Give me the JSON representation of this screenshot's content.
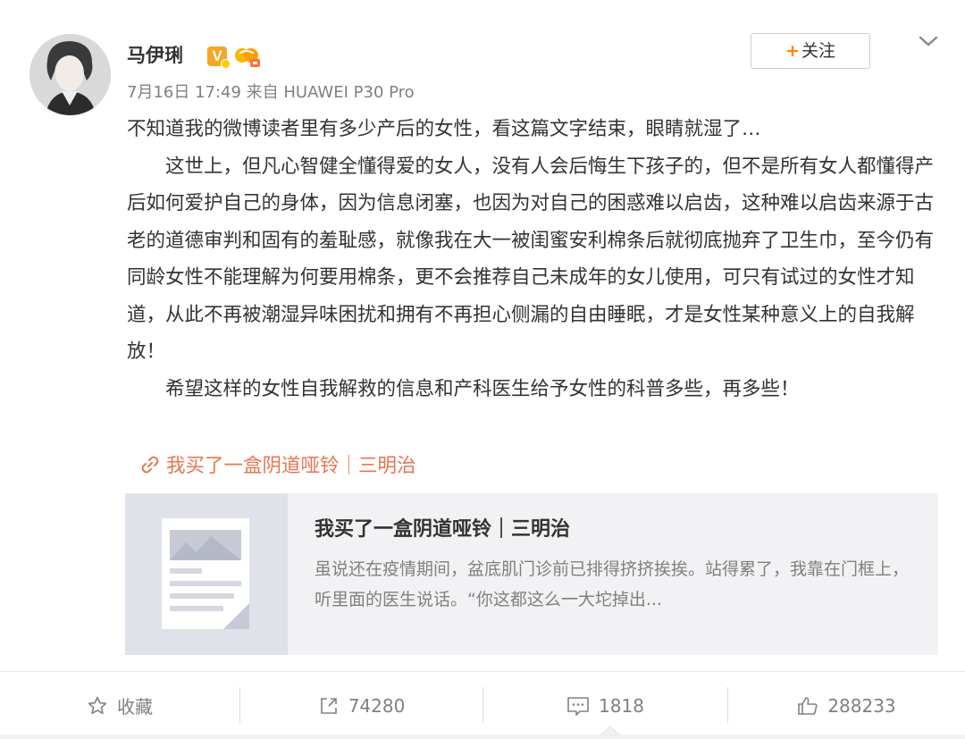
{
  "colors": {
    "accent": "#ff8200",
    "link": "#eb7350",
    "meta": "#808080",
    "text": "#333333",
    "card_bg": "#f2f2f5"
  },
  "post": {
    "author": "马伊琍",
    "verified_badge": "V",
    "meta": "7月16日 17:49 来自 HUAWEI P30 Pro",
    "follow_label": "关注",
    "follow_icon": "plus-icon",
    "menu_icon": "chevron-down-icon",
    "paragraphs": [
      "不知道我的微博读者里有多少产后的女性，看这篇文字结束，眼睛就湿了…",
      "这世上，但凡心智健全懂得爱的女人，没有人会后悔生下孩子的，但不是所有女人都懂得产后如何爱护自己的身体，因为信息闭塞，也因为对自己的困惑难以启齿，这种难以启齿来源于古老的道德审判和固有的羞耻感，就像我在大一被闺蜜安利棉条后就彻底抛弃了卫生巾，至今仍有同龄女性不能理解为何要用棉条，更不会推荐自己未成年的女儿使用，可只有试过的女性才知道，从此不再被潮湿异味困扰和拥有不再担心侧漏的自由睡眠，才是女性某种意义上的自我解放！",
      "希望这样的女性自我解救的信息和产科医生给予女性的科普多些，再多些！"
    ],
    "link_text": "我买了一盒阴道哑铃｜三明治",
    "link_icon": "link-icon"
  },
  "card": {
    "title": "我买了一盒阴道哑铃｜三明治",
    "description": "虽说还在疫情期间，盆底肌门诊前已排得挤挤挨挨。站得累了，我靠在门框上，听里面的医生说话。“你这都这么一大坨掉出...",
    "thumbnail_icon": "article-icon"
  },
  "actions": {
    "favorite": {
      "label": "收藏",
      "icon": "star-icon"
    },
    "repost": {
      "count": "74280",
      "icon": "share-icon"
    },
    "comment": {
      "count": "1818",
      "icon": "comment-icon"
    },
    "like": {
      "count": "288233",
      "icon": "thumbs-up-icon"
    }
  }
}
